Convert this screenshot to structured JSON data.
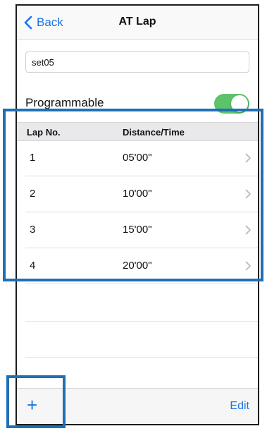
{
  "navbar": {
    "back_label": "Back",
    "title": "AT Lap"
  },
  "name_field": {
    "value": "set05"
  },
  "programmable": {
    "label": "Programmable",
    "enabled": true
  },
  "table": {
    "headers": {
      "lap": "Lap No.",
      "distance": "Distance/Time"
    },
    "rows": [
      {
        "lap": "1",
        "value": "05'00\""
      },
      {
        "lap": "2",
        "value": "10'00\""
      },
      {
        "lap": "3",
        "value": "15'00\""
      },
      {
        "lap": "4",
        "value": "20'00\""
      }
    ]
  },
  "bottom": {
    "add_label": "+",
    "edit_label": "Edit"
  },
  "colors": {
    "accent": "#1a73e8",
    "toggle_on": "#5cc36a",
    "highlight": "#1f6fb5"
  }
}
